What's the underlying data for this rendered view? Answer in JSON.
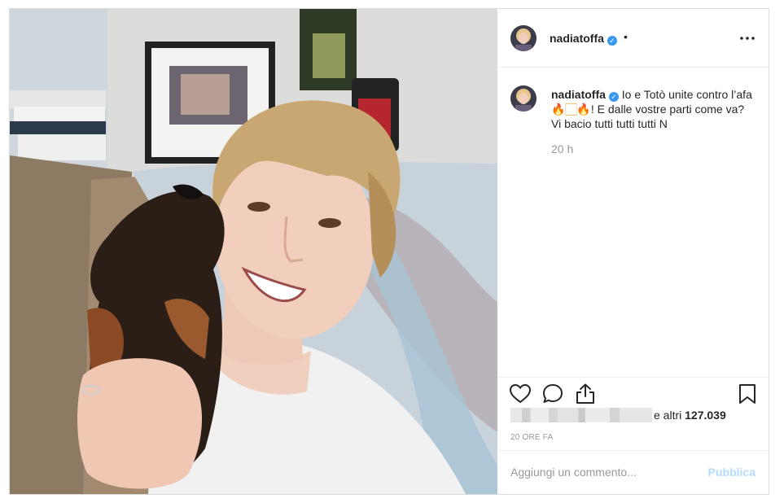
{
  "post": {
    "username": "nadiatoffa",
    "header_separator": "•",
    "verified": true,
    "icons": {
      "more": "more-options-icon",
      "verified": "verified-badge-icon",
      "like": "heart-icon",
      "comment": "comment-bubble-icon",
      "share": "share-icon",
      "save": "bookmark-icon"
    },
    "caption": {
      "username": "nadiatoffa",
      "text_before": "Io e Totò unite contro l’afa ",
      "emoji": "🔥🏻🔥",
      "text_after": "! E dalle vostre parti come va? Vi bacio tutti tutti tutti N",
      "time": "20 h"
    },
    "likes": {
      "prefix": "e altri",
      "count": "127.039"
    },
    "date_label": "20 ORE FA",
    "comment": {
      "placeholder": "Aggiungi un commento...",
      "publish_label": "Pubblica"
    },
    "colors": {
      "verified_blue": "#3897f0",
      "publish_disabled": "#b3dbff",
      "secondary_text": "#999999"
    }
  }
}
